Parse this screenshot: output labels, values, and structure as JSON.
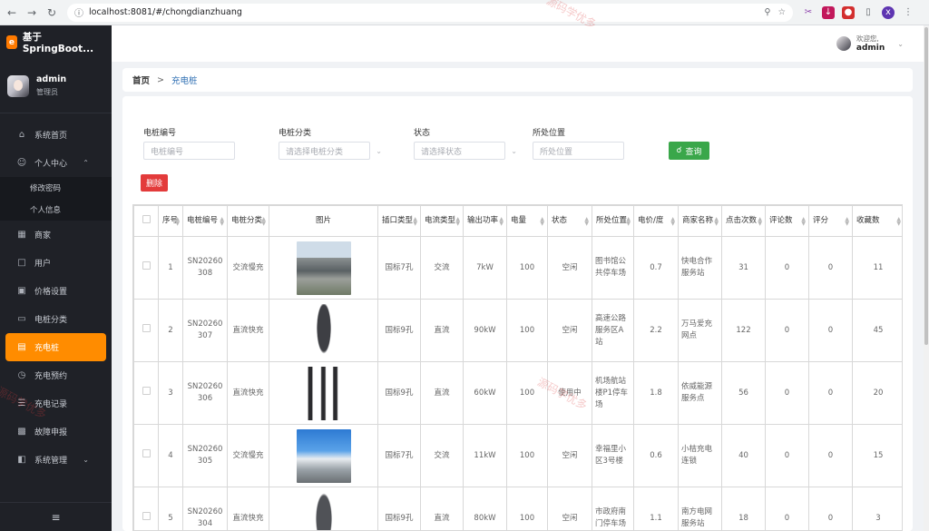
{
  "browser": {
    "url": "localhost:8081/#/chongdianzhuang"
  },
  "app": {
    "title": "基于SpringBoot..."
  },
  "user": {
    "name": "admin",
    "role": "管理员"
  },
  "menu": {
    "items": [
      {
        "label": "系统首页",
        "icon": "home-icon"
      },
      {
        "label": "个人中心",
        "icon": "user-icon"
      },
      {
        "label": "商家",
        "icon": "grid-icon"
      },
      {
        "label": "用户",
        "icon": "doc-icon"
      },
      {
        "label": "价格设置",
        "icon": "image-icon"
      },
      {
        "label": "电桩分类",
        "icon": "monitor-icon"
      },
      {
        "label": "充电桩",
        "icon": "charger-icon"
      },
      {
        "label": "充电预约",
        "icon": "clock-icon"
      },
      {
        "label": "充电记录",
        "icon": "database-icon"
      },
      {
        "label": "故障申报",
        "icon": "tray-icon"
      },
      {
        "label": "系统管理",
        "icon": "settings-icon"
      }
    ],
    "sub": [
      "修改密码",
      "个人信息"
    ]
  },
  "header": {
    "welcome": "欢迎您,",
    "name": "admin"
  },
  "breadcrumb": {
    "home": "首页",
    "sep": ">",
    "current": "充电桩"
  },
  "filters": {
    "f1_label": "电桩编号",
    "f1_ph": "电桩编号",
    "f2_label": "电桩分类",
    "f2_ph": "请选择电桩分类",
    "f3_label": "状态",
    "f3_ph": "请选择状态",
    "f4_label": "所处位置",
    "f4_ph": "所处位置",
    "query": "查询",
    "delete": "删除"
  },
  "table": {
    "headers": [
      "序号",
      "电桩编号",
      "电桩分类",
      "图片",
      "插口类型",
      "电流类型",
      "输出功率",
      "电量",
      "状态",
      "所处位置",
      "电价/度",
      "商家名称",
      "点击次数",
      "评论数",
      "评分",
      "收藏数"
    ],
    "rows": [
      [
        "1",
        "SN20260308",
        "交流慢充",
        "img-a",
        "国标7孔",
        "交流",
        "7kW",
        "100",
        "空闲",
        "图书馆公共停车场",
        "0.7",
        "快电合作服务站",
        "31",
        "0",
        "0",
        "11"
      ],
      [
        "2",
        "SN20260307",
        "直流快充",
        "img-b",
        "国标9孔",
        "直流",
        "90kW",
        "100",
        "空闲",
        "高速公路服务区A站",
        "2.2",
        "万马爱充网点",
        "122",
        "0",
        "0",
        "45"
      ],
      [
        "3",
        "SN20260306",
        "直流快充",
        "img-c",
        "国标9孔",
        "直流",
        "60kW",
        "100",
        "使用中",
        "机场航站楼P1停车场",
        "1.8",
        "依威能源服务点",
        "56",
        "0",
        "0",
        "20"
      ],
      [
        "4",
        "SN20260305",
        "交流慢充",
        "img-d",
        "国标7孔",
        "交流",
        "11kW",
        "100",
        "空闲",
        "幸福里小区3号楼",
        "0.6",
        "小桔充电连锁",
        "40",
        "0",
        "0",
        "15"
      ],
      [
        "5",
        "SN20260304",
        "直流快充",
        "img-e",
        "国标9孔",
        "直流",
        "80kW",
        "100",
        "空闲",
        "市政府南门停车场",
        "1.1",
        "南方电网服务站",
        "18",
        "0",
        "0",
        "3"
      ]
    ]
  },
  "watermark": "源码学优多"
}
